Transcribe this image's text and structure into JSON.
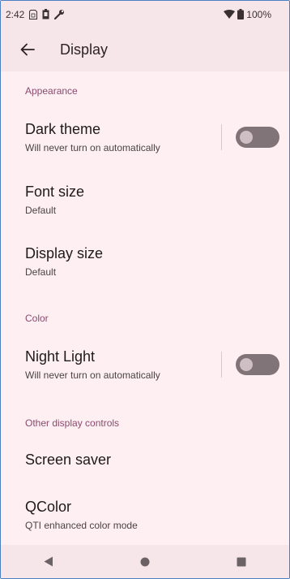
{
  "status_bar": {
    "time": "2:42",
    "battery": "100%"
  },
  "app_bar": {
    "title": "Display"
  },
  "sections": {
    "appearance": "Appearance",
    "color": "Color",
    "other": "Other display controls"
  },
  "prefs": {
    "dark_theme": {
      "title": "Dark theme",
      "summary": "Will never turn on automatically",
      "on": false
    },
    "font_size": {
      "title": "Font size",
      "summary": "Default"
    },
    "display_size": {
      "title": "Display size",
      "summary": "Default"
    },
    "night_light": {
      "title": "Night Light",
      "summary": "Will never turn on automatically",
      "on": false
    },
    "screen_saver": {
      "title": "Screen saver"
    },
    "qcolor": {
      "title": "QColor",
      "summary": "QTI enhanced color mode"
    }
  },
  "colors": {
    "background": "#fdeff2",
    "bar": "#f6e6ea",
    "section_header": "#8a4a6e",
    "switch_track_off": "#817479",
    "switch_thumb_off": "#cdbfc4"
  },
  "icons": {
    "status_left": [
      "sim-icon",
      "battery-saver-icon",
      "wrench-icon"
    ],
    "status_right": [
      "wifi-icon",
      "battery-icon"
    ],
    "back": "arrow-left-icon",
    "nav": [
      "back-triangle-icon",
      "home-circle-icon",
      "recents-square-icon"
    ]
  }
}
